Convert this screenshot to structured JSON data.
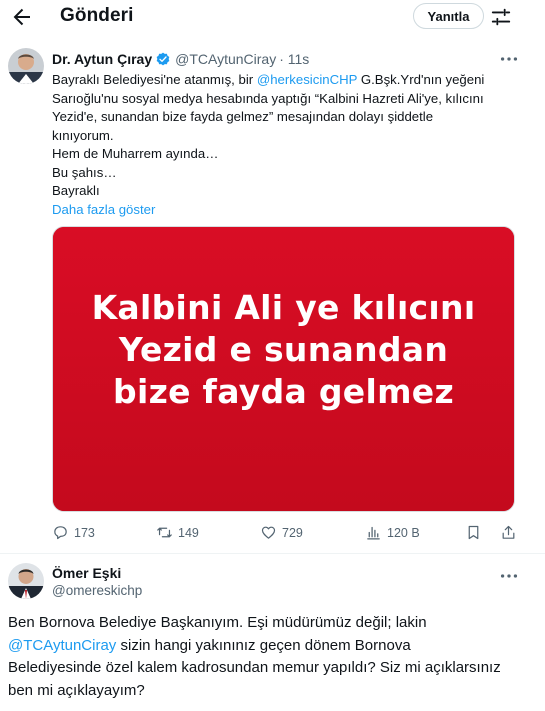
{
  "header": {
    "title": "Gönderi",
    "reply_label": "Yanıtla"
  },
  "tweet1": {
    "author_name": "Dr. Aytun Çıray",
    "handle": "@TCAytunCiray",
    "time": "· 11s",
    "text_lines": [
      {
        "before": "Bayraklı Belediyesi'ne atanmış, bir ",
        "mention": "@herkesicinCHP",
        "after": " G.Bşk.Yrd'nın yeğeni"
      },
      {
        "text": "Sarıoğlu'nu sosyal medya hesabında yaptığı “Kalbini Hazreti Ali'ye, kılıcını"
      },
      {
        "text": "Yezid'e, sunandan bize fayda gelmez” mesajından dolayı şiddetle"
      },
      {
        "text": "kınıyorum."
      },
      {
        "text": "Hem de Muharrem ayında…"
      },
      {
        "text": "Bu şahıs…"
      },
      {
        "text": "Bayraklı"
      }
    ],
    "show_more": "Daha fazla göster",
    "media_text": [
      "Kalbini Ali ye kılıcını",
      "Yezid e sunandan",
      "bize fayda gelmez"
    ],
    "stats": {
      "replies": "173",
      "retweets": "149",
      "likes": "729",
      "views": "120 B"
    }
  },
  "tweet2": {
    "author_name": "Ömer Eşki",
    "handle": "@omereskichp",
    "text_lines": [
      {
        "text": "Ben Bornova Belediye Başkanıyım. Eşi müdürümüz değil; lakin"
      },
      {
        "mention": "@TCAytunCiray",
        "after": " sizin hangi yakınınız geçen dönem Bornova"
      },
      {
        "text": "Belediyesinde özel kalem kadrosundan memur yapıldı? Siz mi açıklarsınız"
      },
      {
        "text": "ben mi açıklayayım?"
      }
    ]
  },
  "colors": {
    "accent": "#1d9bf0",
    "secondary_text": "#536471",
    "media_background": "#d10a22"
  },
  "icons": [
    "back-arrow-icon",
    "settings-sliders-icon",
    "verified-badge-icon",
    "more-icon",
    "reply-icon",
    "retweet-icon",
    "like-icon",
    "views-icon",
    "bookmark-icon",
    "share-icon"
  ]
}
